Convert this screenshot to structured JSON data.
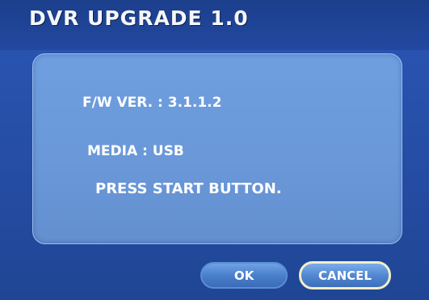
{
  "window": {
    "title": "DVR UPGRADE 1.0"
  },
  "info": {
    "firmware_version": "F/W VER. : 3.1.1.2",
    "media": "MEDIA : USB",
    "prompt": "PRESS START BUTTON."
  },
  "buttons": {
    "ok_label": "OK",
    "cancel_label": "CANCEL"
  },
  "colors": {
    "background": "#264ea6",
    "panel": "#6a98d8",
    "cancel_border": "#f1eec8",
    "text": "#ffffff"
  }
}
